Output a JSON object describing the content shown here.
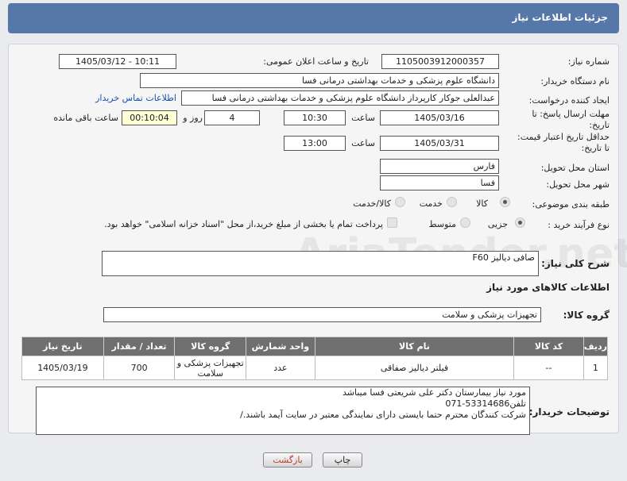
{
  "header": {
    "title": "جزئیات اطلاعات نیاز"
  },
  "labels": {
    "need_number": "شماره نیاز:",
    "announce_datetime": "تاریخ و ساعت اعلان عمومی:",
    "buyer_org": "نام دستگاه خریدار:",
    "creator": "ایجاد کننده درخواست:",
    "buyer_contact": "اطلاعات تماس خریدار",
    "reply_deadline": "مهلت ارسال پاسخ: تا تاریخ:",
    "time_label": "ساعت",
    "days_and": "روز و",
    "remaining": "ساعت باقی مانده",
    "price_validity": "حداقل تاریخ اعتبار قیمت: تا تاریخ:",
    "province": "استان محل تحویل:",
    "city": "شهر محل تحویل:",
    "category": "طبقه بندی موضوعی:",
    "process_type": "نوع فرآیند خرید :",
    "need_summary": "شرح کلی نیاز:",
    "goods_info": "اطلاعات کالاهای مورد نیاز",
    "goods_group": "گروه کالا:",
    "buyer_notes": "توضیحات خریدار:"
  },
  "fields": {
    "need_number": "1105003912000357",
    "announce_datetime": "1405/03/12 - 10:11",
    "buyer_org": "دانشگاه علوم پزشکی و خدمات بهداشتی درمانی فسا",
    "creator": "عبدالعلی جوکار کارپرداز دانشگاه علوم پزشکی و خدمات بهداشتی درمانی فسا",
    "reply_date": "1405/03/16",
    "reply_time": "10:30",
    "reply_days": "4",
    "reply_remaining": "00:10:04",
    "price_date": "1405/03/31",
    "price_time": "13:00",
    "province": "فارس",
    "city": "فسا",
    "need_summary": "صافی دیالیز F60",
    "goods_group": "تجهیزات پزشکی و سلامت",
    "buyer_notes_line1": "مورد نیاز بیمارستان دکتر علی شریعتی فسا میباشد",
    "buyer_notes_line2": "تلفن53314686-071",
    "buyer_notes_line3": "شرکت کنندگان محترم حتما بایستی دارای نمایندگی معتبر در سایت آیمد باشند./"
  },
  "category_options": {
    "goods": "کالا",
    "service": "خدمت",
    "goods_service": "کالا/خدمت",
    "selected": "کالا"
  },
  "process_options": {
    "minor": "جزیی",
    "medium": "متوسط",
    "selected": "جزیی",
    "treasury_note": "پرداخت تمام یا بخشی از مبلغ خرید،از محل \"اسناد خزانه اسلامی\" خواهد بود."
  },
  "table": {
    "headers": [
      "ردیف",
      "کد کالا",
      "نام کالا",
      "واحد شمارش",
      "گروه کالا",
      "تعداد / مقدار",
      "تاریخ نیاز"
    ],
    "rows": [
      [
        "1",
        "--",
        "فیلتر دیالیز صفاقی",
        "عدد",
        "تجهیزات پزشکی و سلامت",
        "700",
        "1405/03/19"
      ]
    ]
  },
  "buttons": {
    "print": "چاپ",
    "back": "بازگشت"
  },
  "watermark": "AriaTender.net",
  "colors": {
    "titlebar": "#5678a8",
    "table_header": "#6f6f6f",
    "back_text": "#c0392b"
  }
}
